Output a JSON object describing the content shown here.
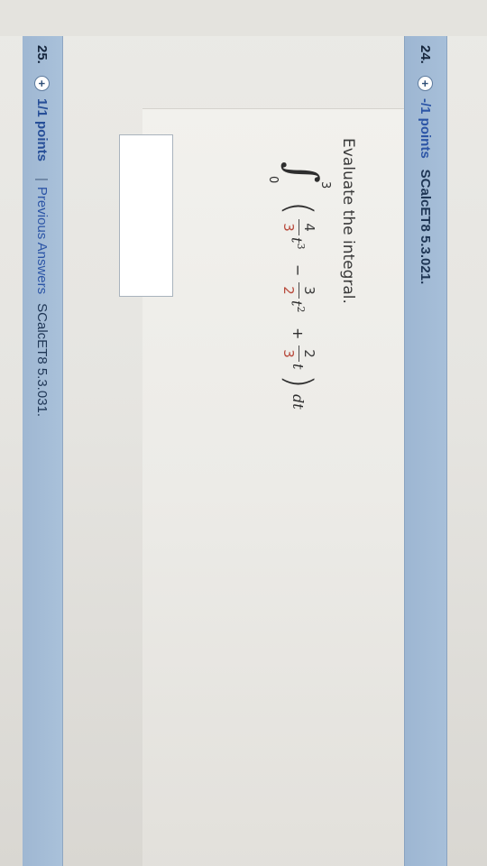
{
  "question24": {
    "number": "24.",
    "icon": "plus-circle-icon",
    "points": "-/1 points",
    "source": "SCalcET8 5.3.021.",
    "instruction": "Evaluate the integral.",
    "integral": {
      "upper_limit": "3",
      "lower_limit": "0",
      "terms": [
        {
          "coef_num": "4",
          "coef_den": "3",
          "var": "t",
          "power": "3"
        },
        {
          "op": "−"
        },
        {
          "coef_num": "3",
          "coef_den": "2",
          "var": "t",
          "power": "2"
        },
        {
          "op": "+"
        },
        {
          "coef_num": "2",
          "coef_den": "3",
          "var": "t",
          "power": ""
        }
      ],
      "differential": "dt"
    },
    "answer_value": ""
  },
  "question25": {
    "number": "25.",
    "icon": "plus-circle-icon",
    "points": "1/1 points",
    "separator": "|",
    "previous_answers": "Previous Answers",
    "source": "SCalcET8 5.3.031."
  },
  "colors": {
    "header_bg": "#a7bfd9",
    "points_link": "#2c55a6",
    "denominator": "#b84a3c"
  }
}
